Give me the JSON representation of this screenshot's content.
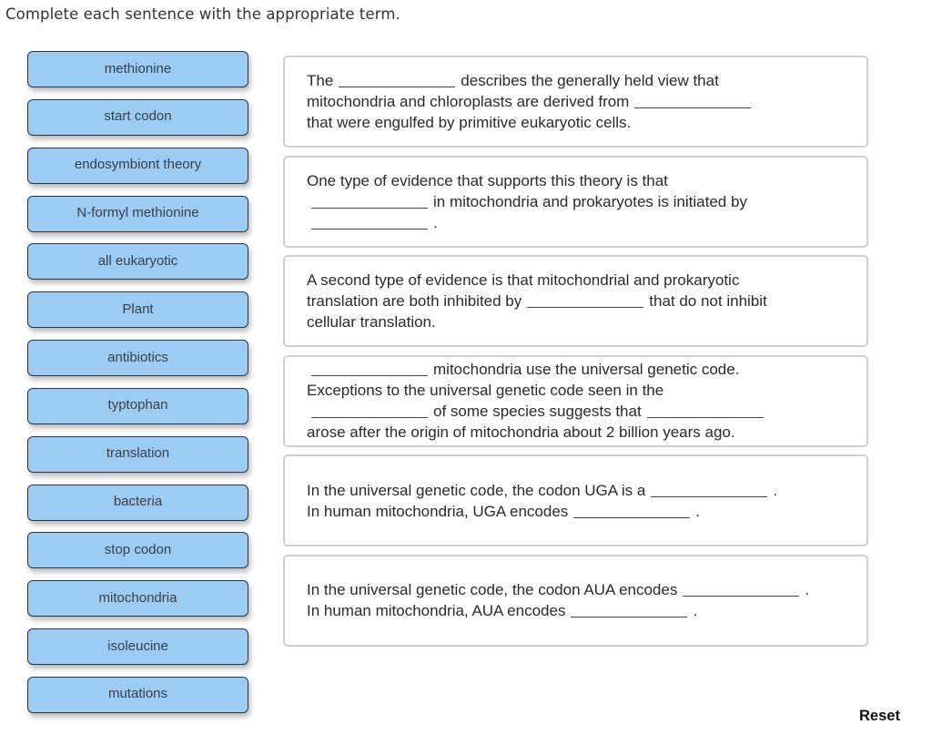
{
  "instructions": "Complete each sentence with the appropriate term.",
  "terms": [
    "methionine",
    "start codon",
    "endosymbiont theory",
    "N-formyl methionine",
    "all eukaryotic",
    "Plant",
    "antibiotics",
    "typtophan",
    "translation",
    "bacteria",
    "stop codon",
    "mitochondria",
    "isoleucine",
    "mutations"
  ],
  "sentences": [
    {
      "parts": [
        "The",
        "{blank}",
        "describes the generally held view that",
        "{br}",
        "mitochondria and chloroplasts are derived from",
        "{blank}",
        "{br}",
        "that were engulfed by primitive eukaryotic cells."
      ]
    },
    {
      "parts": [
        "One type of evidence that supports this theory is that",
        "{br}",
        "{blank}",
        "in mitochondria and prokaryotes is initiated by",
        "{br}",
        "{blank}",
        "."
      ]
    },
    {
      "parts": [
        "A second type of evidence is that mitochondrial and prokaryotic",
        "{br}",
        "translation are both inhibited by",
        "{blank}",
        "that do not inhibit",
        "{br}",
        "cellular translation."
      ]
    },
    {
      "parts": [
        "{blank}",
        "mitochondria use the universal genetic code.",
        "{br}",
        "Exceptions to the universal genetic code seen in the",
        "{br}",
        "{blank}",
        "of some species suggests that",
        "{blank}",
        "{br}",
        "arose after the origin of mitochondria about 2 billion years ago."
      ]
    },
    {
      "parts": [
        "In the universal genetic code, the codon UGA is a",
        "{blank}",
        ".",
        "{br}",
        "In human mitochondria, UGA encodes",
        "{blank}",
        "."
      ]
    },
    {
      "parts": [
        "In the universal genetic code, the codon AUA encodes",
        "{blank}",
        ".",
        "{br}",
        "In human mitochondria, AUA encodes",
        "{blank}",
        "."
      ]
    }
  ],
  "reset_label": "Reset",
  "colors": {
    "term_fill": "#9ccbf3",
    "term_border": "#2d3640",
    "box_border": "#d0d0d0"
  }
}
